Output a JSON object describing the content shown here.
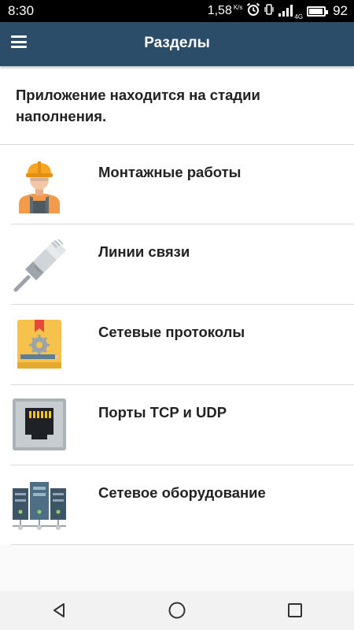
{
  "status_bar": {
    "time": "8:30",
    "speed_value": "1,58",
    "speed_unit": "K/s",
    "network_type": "4G",
    "battery_level": "92"
  },
  "app_bar": {
    "title": "Разделы"
  },
  "intro_text": "Приложение находится на стадии наполнения.",
  "sections": [
    {
      "label": "Монтажные работы",
      "icon": "worker-icon"
    },
    {
      "label": "Линии связи",
      "icon": "network-cable-icon"
    },
    {
      "label": "Сетевые протоколы",
      "icon": "protocol-book-icon"
    },
    {
      "label": "Порты TCP и UDP",
      "icon": "ethernet-port-icon"
    },
    {
      "label": "Сетевое оборудование",
      "icon": "server-rack-icon"
    }
  ],
  "colors": {
    "app_bar": "#2c4d69",
    "status_bar": "#000000",
    "divider": "#d9d9d9"
  }
}
